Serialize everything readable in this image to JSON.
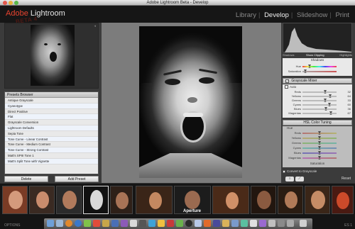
{
  "window": {
    "title": "Adobe Lightroom Beta - Develop",
    "close_color": "#e2574c",
    "minimize_color": "#e8b33b",
    "zoom_color": "#59b84a"
  },
  "identity": {
    "adobe": "Adobe",
    "product": "Lightroom",
    "beta_mark": "BETA 4"
  },
  "modules": {
    "items": [
      "Library",
      "Develop",
      "Slideshow",
      "Print"
    ],
    "active": "Develop"
  },
  "left_panel": {
    "navigator_close": "◂",
    "presets_title": "Presets Browser",
    "presets": [
      "Antique Grayscale",
      "Cyanotype",
      "Direct Positive",
      "Flat",
      "Grayscale Conversion",
      "Lightroom Defaults",
      "Sepia Tone",
      "Tone Curve - Linear Contrast",
      "Tone Curve - Medium Contrast",
      "Tone Curve - Strong Contrast",
      "Matt's SPIII Tone 1",
      "Matt's Split Tone with Vignette"
    ],
    "delete_label": "Delete",
    "add_preset_label": "Add Preset"
  },
  "histogram": {
    "shadows_label": "Shadows",
    "clipping_label": "Show Clipping",
    "highlights_label": "Highlights"
  },
  "split_toning": {
    "title": "Shadows",
    "rows": [
      {
        "label": "Hue",
        "value": ""
      },
      {
        "label": "Saturation",
        "value": ""
      }
    ]
  },
  "grayscale_mixer": {
    "title": "Grayscale Mixer",
    "auto_label": "Auto",
    "rows": [
      {
        "label": "Reds",
        "value": "32"
      },
      {
        "label": "Yellows",
        "value": "64"
      },
      {
        "label": "Greens",
        "value": "33"
      },
      {
        "label": "Cyans",
        "value": "60"
      },
      {
        "label": "Blues",
        "value": "36"
      },
      {
        "label": "Magentas",
        "value": "67"
      }
    ]
  },
  "hsl": {
    "title": "HSL Color Tuning",
    "hue_label": "Hue",
    "rows": [
      "Reds",
      "Yellows",
      "Greens",
      "Cyans",
      "Blues",
      "Magentas"
    ],
    "saturation_label": "Saturation"
  },
  "convert_to_grayscale_label": "Convert to Grayscale",
  "reset_label": "Reset",
  "filmstrip": {
    "caption": "Aperture"
  },
  "dock": {
    "left_label": "OPTIONS",
    "right_label": "ES  1"
  }
}
